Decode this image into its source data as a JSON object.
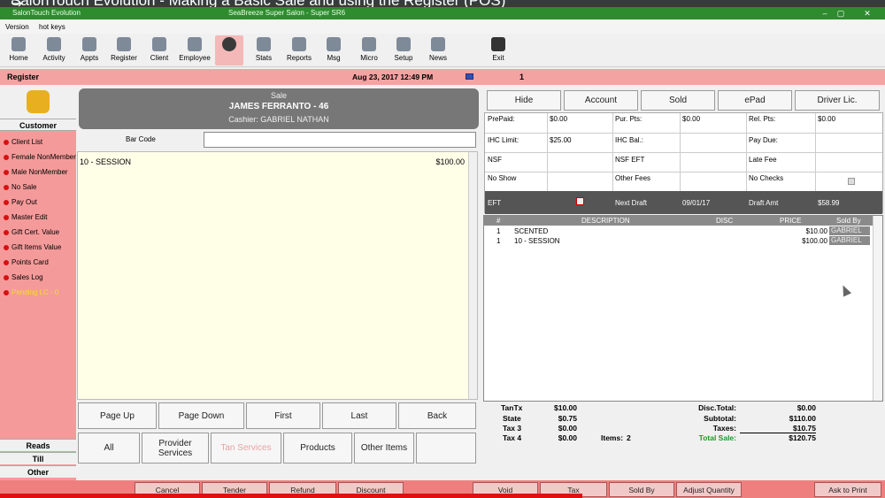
{
  "video": {
    "title": "SalonTouch Evolution - Making a Basic Sale and using the Register (POS)"
  },
  "window": {
    "title": "SalonTouch Evolution",
    "subtitle": "SeaBreeze Super Salon - Super SR6",
    "controls": [
      "–",
      "▢",
      "✕"
    ]
  },
  "menu": {
    "items": [
      "Version",
      "hot keys"
    ]
  },
  "toolbar": {
    "items": [
      {
        "label": "Home",
        "icon": "home-icon"
      },
      {
        "label": "Activity",
        "icon": "activity-icon"
      },
      {
        "label": "Appts",
        "icon": "appointments-icon"
      },
      {
        "label": "Register",
        "icon": "cart-icon"
      },
      {
        "label": "Client",
        "icon": "client-icon"
      },
      {
        "label": "Employee",
        "icon": "employee-icon"
      },
      {
        "label": "",
        "icon": "active-user-icon"
      },
      {
        "label": "Stats",
        "icon": "stats-icon"
      },
      {
        "label": "Reports",
        "icon": "reports-icon"
      },
      {
        "label": "Msg",
        "icon": "message-icon"
      },
      {
        "label": "Micro",
        "icon": "micro-icon"
      },
      {
        "label": "Setup",
        "icon": "setup-icon"
      },
      {
        "label": "News",
        "icon": "news-icon"
      },
      {
        "label": "Exit",
        "icon": "exit-icon"
      }
    ]
  },
  "register": {
    "label": "Register",
    "datetime": "Aug 23, 2017 12:49 PM",
    "station": "1"
  },
  "left": {
    "customer_header": "Customer",
    "items": [
      "Client List",
      "Female NonMember",
      "Male NonMember",
      "No Sale",
      "Pay Out",
      "Master Edit",
      "Gift Cert. Value",
      "Gift Items Value",
      "Points Card",
      "Sales Log",
      "Pending LC - 0"
    ],
    "sections": [
      "Reads",
      "Till",
      "Other"
    ]
  },
  "sale": {
    "type": "Sale",
    "customer": "JAMES FERRANTO - 46",
    "cashier": "Cashier: GABRIEL NATHAN"
  },
  "barcode": {
    "label": "Bar Code",
    "value": ""
  },
  "sale_list": {
    "item": "10 - SESSION",
    "price": "$100.00"
  },
  "nav_buttons": [
    "Page Up",
    "Page Down",
    "First",
    "Last",
    "Back"
  ],
  "category_buttons": [
    "All",
    "Provider Services",
    "Tan Services",
    "Products",
    "Other Items",
    ""
  ],
  "top_buttons": [
    "Hide",
    "Account",
    "Sold",
    "ePad",
    "Driver Lic."
  ],
  "info": {
    "prepaid_label": "PrePaid:",
    "prepaid": "$0.00",
    "pur_pts_label": "Pur. Pts:",
    "pur_pts": "$0.00",
    "rel_pts_label": "Rel. Pts:",
    "rel_pts": "$0.00",
    "ihc_limit_label": "IHC Limit:",
    "ihc_limit": "$25.00",
    "ihc_bal_label": "IHC Bal.:",
    "pay_due_label": "Pay Due:",
    "nsf_label": "NSF",
    "nsf_eft_label": "NSF EFT",
    "late_fee_label": "Late Fee",
    "no_show_label": "No Show",
    "other_fees_label": "Other Fees",
    "no_checks_label": "No Checks",
    "eft_label": "EFT",
    "next_draft_label": "Next Draft",
    "next_draft": "09/01/17",
    "draft_amt_label": "Draft Amt",
    "draft_amt": "$58.99"
  },
  "grid": {
    "headers": [
      "#",
      "DESCRIPTION",
      "DISC",
      "PRICE",
      "Sold By"
    ],
    "rows": [
      {
        "qty": "1",
        "desc": "SCENTED",
        "disc": "",
        "price": "$10.00",
        "sold_by": "GABRIEL"
      },
      {
        "qty": "1",
        "desc": "10 - SESSION",
        "disc": "",
        "price": "$100.00",
        "sold_by": "GABRIEL"
      }
    ]
  },
  "totals": {
    "tantx_label": "TanTx",
    "tantx": "$10.00",
    "state_label": "State",
    "state": "$0.75",
    "tax3_label": "Tax 3",
    "tax3": "$0.00",
    "tax4_label": "Tax 4",
    "tax4": "$0.00",
    "items_label": "Items:",
    "items": "2",
    "disc_total_label": "Disc.Total:",
    "disc_total": "$0.00",
    "subtotal_label": "Subtotal:",
    "subtotal": "$110.00",
    "taxes_label": "Taxes:",
    "taxes": "$10.75",
    "total_sale_label": "Total Sale:",
    "total_sale": "$120.75"
  },
  "bottom_buttons": [
    "Cancel",
    "Tender",
    "Refund",
    "Discount",
    "Void",
    "Tax",
    "Sold By",
    "Adjust Quantity",
    "Ask to Print"
  ],
  "colors": {
    "accent": "#f4a3a3",
    "titlebar": "#2e8b2e",
    "total_sale": "#1a9a2a"
  }
}
